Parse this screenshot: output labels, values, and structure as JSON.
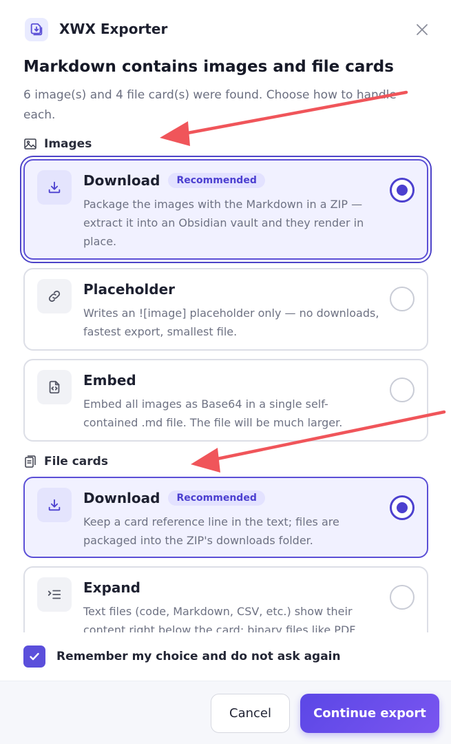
{
  "app": {
    "title": "XWX Exporter",
    "logo_icon": "document-upload-icon",
    "close_icon": "close-icon"
  },
  "dialog": {
    "title": "Markdown contains images and file cards",
    "subtitle": "6 image(s) and 4 file card(s) were found. Choose how to handle each."
  },
  "images_section": {
    "label": "Images",
    "icon": "image-icon",
    "options": [
      {
        "title": "Download",
        "badge": "Recommended",
        "icon": "download-icon",
        "selected": true,
        "description": "Package the images with the Markdown in a ZIP — extract it into an Obsidian vault and they render in place."
      },
      {
        "title": "Placeholder",
        "icon": "link-icon",
        "selected": false,
        "description": "Writes an ![image] placeholder only — no downloads, fastest export, smallest file."
      },
      {
        "title": "Embed",
        "icon": "code-file-icon",
        "selected": false,
        "description": "Embed all images as Base64 in a single self-contained .md file. The file will be much larger."
      }
    ]
  },
  "file_cards_section": {
    "label": "File cards",
    "icon": "files-icon",
    "options": [
      {
        "title": "Download",
        "badge": "Recommended",
        "icon": "download-icon",
        "selected": true,
        "description": "Keep a card reference line in the text; files are packaged into the ZIP's downloads folder."
      },
      {
        "title": "Expand",
        "icon": "indent-list-icon",
        "selected": false,
        "description": "Text files (code, Markdown, CSV, etc.) show their content right below the card; binary files like PDF"
      }
    ]
  },
  "remember": {
    "label": "Remember my choice and do not ask again",
    "checked": true
  },
  "footer": {
    "cancel_label": "Cancel",
    "continue_label": "Continue export"
  },
  "colors": {
    "accent": "#5b4fd6",
    "annotation_arrow": "#f0555a"
  }
}
